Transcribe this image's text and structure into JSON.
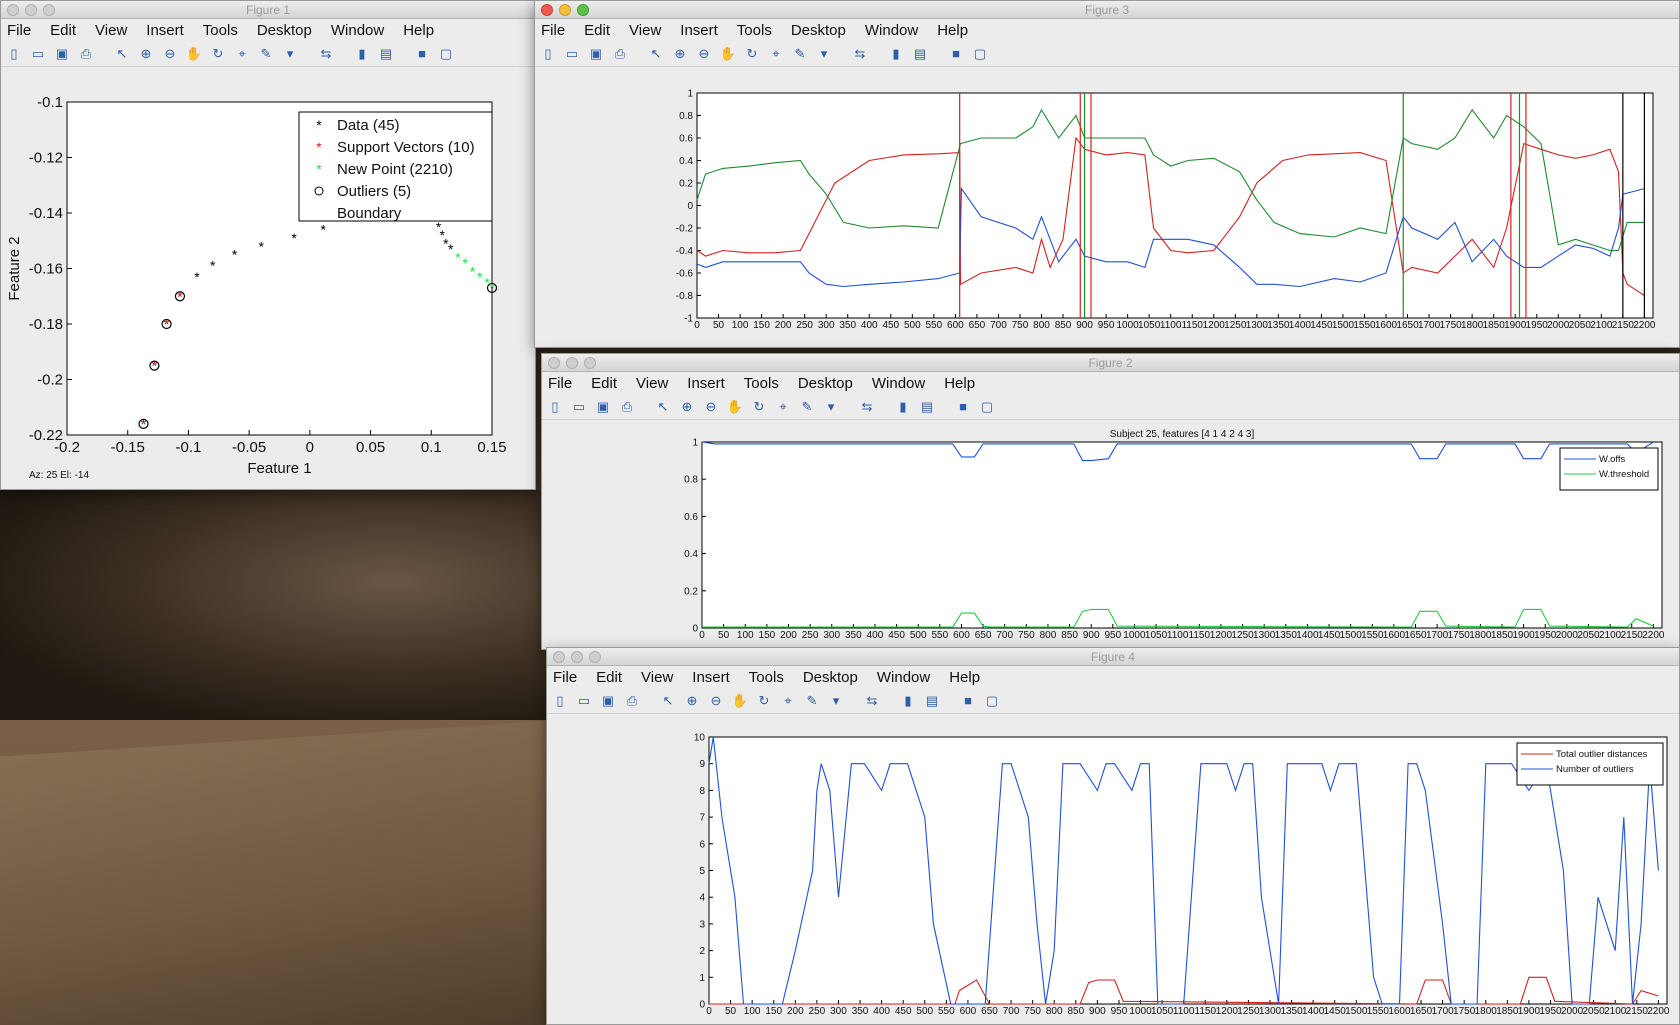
{
  "menus": [
    "File",
    "Edit",
    "View",
    "Insert",
    "Tools",
    "Desktop",
    "Window",
    "Help"
  ],
  "toolbar_icons": [
    "new-file-icon",
    "open-folder-icon",
    "save-icon",
    "print-icon",
    "pointer-icon",
    "zoom-in-icon",
    "zoom-out-icon",
    "pan-icon",
    "rotate-icon",
    "data-cursor-icon",
    "brush-icon",
    "dropdown-icon",
    "link-icon",
    "colorbar-icon",
    "legend-icon",
    "hide-plot-icon",
    "show-plot-icon"
  ],
  "fig1": {
    "title": "Figure 1",
    "status": "Az:   25 El:   -14",
    "chart_data": {
      "type": "scatter",
      "xlabel": "Feature 1",
      "ylabel": "Feature 2",
      "xlim": [
        -0.2,
        0.15
      ],
      "ylim": [
        -0.22,
        -0.1
      ],
      "xticks": [
        "-0.2",
        "-0.15",
        "-0.1",
        "-0.05",
        "0",
        "0.05",
        "0.1",
        "0.15"
      ],
      "yticks": [
        "-0.1",
        "-0.12",
        "-0.14",
        "-0.16",
        "-0.18",
        "-0.2",
        "-0.22"
      ],
      "legend_position": "top-right",
      "legend": [
        "Data (45)",
        "Support Vectors (10)",
        "New Point (2210)",
        "Outliers (5)",
        "Boundary"
      ],
      "series": [
        {
          "name": "Data (45)",
          "marker": "*",
          "color": "#000000",
          "points": [
            [
              -0.137,
              -0.216
            ],
            [
              -0.128,
              -0.195
            ],
            [
              -0.118,
              -0.18
            ],
            [
              -0.107,
              -0.17
            ],
            [
              -0.093,
              -0.163
            ],
            [
              -0.08,
              -0.159
            ],
            [
              -0.062,
              -0.155
            ],
            [
              -0.04,
              -0.152
            ],
            [
              -0.013,
              -0.149
            ],
            [
              0.011,
              -0.146
            ],
            [
              0.037,
              -0.143
            ],
            [
              0.06,
              -0.14
            ],
            [
              0.082,
              -0.139
            ],
            [
              0.1,
              -0.142
            ],
            [
              0.106,
              -0.145
            ],
            [
              0.109,
              -0.148
            ],
            [
              0.112,
              -0.151
            ],
            [
              0.116,
              -0.153
            ]
          ]
        },
        {
          "name": "Support Vectors (10)",
          "marker": "*",
          "color": "#e02020",
          "points": [
            [
              -0.137,
              -0.216
            ],
            [
              -0.128,
              -0.195
            ],
            [
              -0.118,
              -0.18
            ],
            [
              -0.107,
              -0.17
            ]
          ]
        },
        {
          "name": "New Point (2210)",
          "marker": "*",
          "color": "#22dd44",
          "points": [
            [
              0.122,
              -0.156
            ],
            [
              0.128,
              -0.158
            ],
            [
              0.134,
              -0.161
            ],
            [
              0.14,
              -0.163
            ],
            [
              0.146,
              -0.165
            ],
            [
              0.15,
              -0.167
            ]
          ]
        },
        {
          "name": "Outliers (5)",
          "marker": "o",
          "color": "#000000",
          "points": [
            [
              -0.137,
              -0.216
            ],
            [
              -0.128,
              -0.195
            ],
            [
              -0.118,
              -0.18
            ],
            [
              -0.107,
              -0.17
            ],
            [
              0.15,
              -0.167
            ]
          ]
        }
      ]
    }
  },
  "fig3": {
    "title": "Figure 3",
    "chart_data": {
      "type": "line",
      "xlim": [
        0,
        2220
      ],
      "ylim": [
        -1,
        1
      ],
      "xticks": [
        "0",
        "50",
        "100",
        "150",
        "200",
        "250",
        "300",
        "350",
        "400",
        "450",
        "500",
        "550",
        "600",
        "650",
        "700",
        "750",
        "800",
        "850",
        "900",
        "950",
        "1000",
        "1050",
        "1100",
        "1150",
        "1200",
        "1250",
        "1300",
        "1350",
        "1400",
        "1450",
        "1500",
        "1550",
        "1600",
        "1650",
        "1700",
        "1750",
        "1800",
        "1850",
        "1900",
        "1950",
        "2000",
        "2050",
        "2100",
        "2150",
        "2200"
      ],
      "yticks": [
        "1",
        "0.8",
        "0.6",
        "0.4",
        "0.2",
        "0",
        "-0.2",
        "-0.4",
        "-0.6",
        "-0.8",
        "-1"
      ],
      "series": [
        {
          "color": "#d42020",
          "x": [
            0,
            20,
            60,
            120,
            180,
            240,
            280,
            320,
            400,
            480,
            560,
            610,
            612,
            660,
            740,
            780,
            800,
            820,
            850,
            880,
            900,
            950,
            1000,
            1040,
            1060,
            1100,
            1140,
            1200,
            1260,
            1300,
            1360,
            1420,
            1480,
            1540,
            1600,
            1640,
            1660,
            1720,
            1800,
            1850,
            1880,
            1920,
            1960,
            2000,
            2040,
            2080,
            2120,
            2140,
            2150,
            2160,
            2180,
            2200
          ],
          "values": [
            -0.4,
            -0.45,
            -0.4,
            -0.42,
            -0.42,
            -0.4,
            -0.1,
            0.2,
            0.4,
            0.45,
            0.46,
            0.47,
            -0.7,
            -0.6,
            -0.55,
            -0.6,
            -0.3,
            -0.55,
            -0.3,
            0.6,
            0.5,
            0.45,
            0.47,
            0.45,
            -0.2,
            -0.4,
            -0.42,
            -0.4,
            -0.1,
            0.2,
            0.4,
            0.45,
            0.46,
            0.47,
            0.4,
            -0.6,
            -0.55,
            -0.6,
            -0.3,
            -0.55,
            -0.2,
            0.55,
            0.5,
            0.45,
            0.42,
            0.45,
            0.5,
            0.3,
            -0.6,
            -0.7,
            -0.75,
            -0.8
          ]
        },
        {
          "color": "#1f8a30",
          "x": [
            0,
            20,
            60,
            120,
            180,
            240,
            260,
            300,
            340,
            400,
            480,
            560,
            612,
            660,
            740,
            780,
            800,
            840,
            880,
            900,
            950,
            1000,
            1040,
            1060,
            1100,
            1140,
            1200,
            1260,
            1300,
            1340,
            1400,
            1480,
            1540,
            1600,
            1640,
            1660,
            1720,
            1760,
            1800,
            1850,
            1880,
            1920,
            1960,
            2000,
            2040,
            2080,
            2120,
            2140,
            2160,
            2200
          ],
          "values": [
            0.05,
            0.28,
            0.33,
            0.35,
            0.38,
            0.4,
            0.28,
            0.1,
            -0.15,
            -0.2,
            -0.18,
            -0.2,
            0.55,
            0.6,
            0.6,
            0.7,
            0.85,
            0.6,
            0.8,
            0.6,
            0.6,
            0.6,
            0.6,
            0.45,
            0.35,
            0.4,
            0.42,
            0.3,
            0.05,
            -0.15,
            -0.25,
            -0.28,
            -0.2,
            -0.25,
            0.6,
            0.55,
            0.5,
            0.6,
            0.85,
            0.6,
            0.8,
            0.7,
            0.55,
            -0.35,
            -0.3,
            -0.35,
            -0.4,
            -0.4,
            -0.15,
            -0.15
          ]
        },
        {
          "color": "#2050d8",
          "x": [
            0,
            20,
            60,
            120,
            180,
            240,
            260,
            300,
            340,
            400,
            480,
            560,
            610,
            614,
            660,
            740,
            780,
            800,
            840,
            880,
            900,
            950,
            1000,
            1040,
            1060,
            1100,
            1140,
            1200,
            1260,
            1300,
            1340,
            1400,
            1480,
            1540,
            1600,
            1640,
            1660,
            1720,
            1760,
            1800,
            1850,
            1880,
            1920,
            1960,
            2000,
            2040,
            2080,
            2120,
            2140,
            2150,
            2170,
            2200
          ],
          "values": [
            -0.52,
            -0.55,
            -0.5,
            -0.5,
            -0.5,
            -0.5,
            -0.6,
            -0.7,
            -0.72,
            -0.7,
            -0.68,
            -0.65,
            -0.6,
            0.15,
            -0.1,
            -0.2,
            -0.3,
            -0.1,
            -0.5,
            -0.3,
            -0.45,
            -0.5,
            -0.5,
            -0.55,
            -0.3,
            -0.3,
            -0.3,
            -0.35,
            -0.55,
            -0.7,
            -0.7,
            -0.72,
            -0.65,
            -0.68,
            -0.6,
            -0.1,
            -0.2,
            -0.3,
            -0.15,
            -0.5,
            -0.3,
            -0.45,
            -0.55,
            -0.55,
            -0.45,
            -0.35,
            -0.38,
            -0.45,
            -0.2,
            0.1,
            0.12,
            0.15
          ]
        }
      ]
    }
  },
  "fig2": {
    "title": "Figure 2",
    "chart_data": {
      "type": "line",
      "title": "Subject 25, features [4 1 4 2 4 3]",
      "xlim": [
        0,
        2220
      ],
      "ylim": [
        0,
        1
      ],
      "xticks": [
        "0",
        "50",
        "100",
        "150",
        "200",
        "250",
        "300",
        "350",
        "400",
        "450",
        "500",
        "550",
        "600",
        "650",
        "700",
        "750",
        "800",
        "850",
        "900",
        "950",
        "1000",
        "1050",
        "1100",
        "1150",
        "1200",
        "1250",
        "1300",
        "1350",
        "1400",
        "1450",
        "1500",
        "1550",
        "1600",
        "1650",
        "1700",
        "1750",
        "1800",
        "1850",
        "1900",
        "1950",
        "2000",
        "2050",
        "2100",
        "2150",
        "2200"
      ],
      "yticks": [
        "1",
        "0.8",
        "0.6",
        "0.4",
        "0.2",
        "0"
      ],
      "legend_position": "top-right",
      "legend": [
        "W.offs",
        "W.threshold"
      ],
      "series": [
        {
          "name": "W.offs",
          "color": "#2050d8",
          "x": [
            0,
            30,
            580,
            600,
            630,
            650,
            670,
            860,
            880,
            900,
            940,
            960,
            1640,
            1660,
            1700,
            1720,
            1880,
            1900,
            1940,
            1960,
            2140,
            2160,
            2200
          ],
          "values": [
            1,
            0.99,
            0.99,
            0.92,
            0.92,
            0.99,
            0.99,
            0.99,
            0.9,
            0.9,
            0.91,
            0.99,
            0.99,
            0.91,
            0.91,
            0.99,
            0.99,
            0.91,
            0.91,
            0.99,
            0.99,
            0.94,
            1
          ]
        },
        {
          "name": "W.threshold",
          "color": "#22cc44",
          "x": [
            0,
            580,
            600,
            630,
            650,
            670,
            860,
            880,
            900,
            940,
            960,
            1640,
            1660,
            1700,
            1720,
            1880,
            1900,
            1940,
            1960,
            2140,
            2160,
            2200
          ],
          "values": [
            0.005,
            0.005,
            0.08,
            0.08,
            0.01,
            0.005,
            0.005,
            0.09,
            0.1,
            0.1,
            0.01,
            0.005,
            0.09,
            0.09,
            0.01,
            0.005,
            0.1,
            0.1,
            0.01,
            0.005,
            0.05,
            0.01
          ]
        }
      ]
    }
  },
  "fig4": {
    "title": "Figure 4",
    "chart_data": {
      "type": "line",
      "xlim": [
        0,
        2220
      ],
      "ylim": [
        0,
        10
      ],
      "xticks": [
        "0",
        "50",
        "100",
        "150",
        "200",
        "250",
        "300",
        "350",
        "400",
        "450",
        "500",
        "550",
        "600",
        "650",
        "700",
        "750",
        "800",
        "850",
        "900",
        "950",
        "1000",
        "1050",
        "1100",
        "1150",
        "1200",
        "1250",
        "1300",
        "1350",
        "1400",
        "1450",
        "1500",
        "1550",
        "1600",
        "1650",
        "1700",
        "1750",
        "1800",
        "1850",
        "1900",
        "1950",
        "2000",
        "2050",
        "2100",
        "2150",
        "2200"
      ],
      "yticks": [
        "10",
        "9",
        "8",
        "7",
        "6",
        "5",
        "4",
        "3",
        "2",
        "1",
        "0"
      ],
      "legend_position": "top-right",
      "legend": [
        "Total outlier distances",
        "Number of outliers"
      ],
      "series": [
        {
          "name": "Total outlier distances",
          "color": "#d42020",
          "x": [
            0,
            570,
            580,
            620,
            650,
            860,
            880,
            900,
            940,
            960,
            1640,
            1660,
            1700,
            1720,
            1880,
            1900,
            1940,
            1960,
            2140,
            2160,
            2200
          ],
          "values": [
            0,
            0,
            0.5,
            0.9,
            0,
            0,
            0.8,
            0.9,
            0.9,
            0.1,
            0,
            0.9,
            0.9,
            0,
            0,
            1.0,
            1.0,
            0.1,
            0,
            0.5,
            0.3
          ]
        },
        {
          "name": "Number of outliers",
          "color": "#2050d8",
          "x": [
            0,
            10,
            30,
            60,
            80,
            150,
            170,
            200,
            240,
            250,
            260,
            280,
            300,
            330,
            360,
            400,
            420,
            460,
            500,
            520,
            560,
            600,
            620,
            640,
            680,
            700,
            740,
            760,
            780,
            800,
            820,
            840,
            860,
            900,
            920,
            940,
            980,
            1000,
            1020,
            1040,
            1080,
            1100,
            1140,
            1160,
            1200,
            1220,
            1240,
            1260,
            1280,
            1320,
            1340,
            1380,
            1420,
            1440,
            1460,
            1500,
            1540,
            1560,
            1600,
            1620,
            1640,
            1660,
            1700,
            1720,
            1780,
            1800,
            1820,
            1860,
            1900,
            1940,
            1980,
            2000,
            2040,
            2060,
            2100,
            2120,
            2140,
            2160,
            2180,
            2200
          ],
          "values": [
            9,
            10,
            7,
            4,
            0,
            0,
            0,
            2,
            5,
            8,
            9,
            8,
            4,
            9,
            9,
            8,
            9,
            9,
            7,
            3,
            0,
            0,
            0,
            0,
            9,
            9,
            7,
            3,
            0,
            2,
            9,
            9,
            9,
            8,
            9,
            9,
            8,
            9,
            9,
            0,
            0,
            0,
            9,
            9,
            9,
            8,
            9,
            9,
            4,
            0,
            9,
            9,
            9,
            8,
            9,
            9,
            1,
            0,
            0,
            9,
            9,
            8,
            3,
            0,
            0,
            9,
            9,
            9,
            8,
            9,
            5,
            0,
            0,
            4,
            2,
            7,
            0,
            3,
            9,
            5
          ]
        }
      ]
    }
  }
}
